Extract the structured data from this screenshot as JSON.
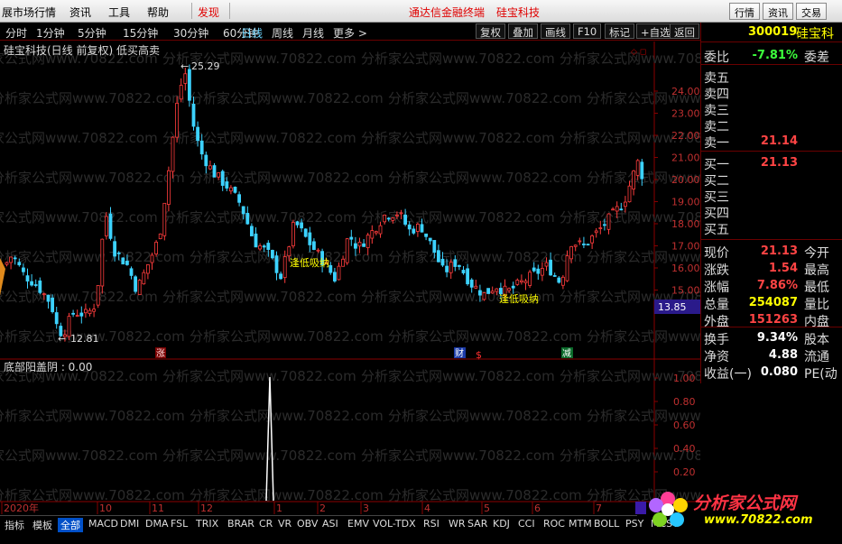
{
  "menu": {
    "items": [
      "展市场行情",
      "资讯",
      "工具",
      "帮助"
    ],
    "discover": "发现",
    "center_title": "通达信金融终端",
    "stock_name_top": "硅宝科技",
    "right_buttons": [
      "行情",
      "资讯",
      "交易"
    ]
  },
  "periods": [
    "分时",
    "1分钟",
    "5分钟",
    "15分钟",
    "30分钟",
    "60分钟",
    "日线",
    "周线",
    "月线",
    "更多 >"
  ],
  "active_period": "日线",
  "toolbar": [
    "复权",
    "叠加",
    "画线",
    "F10",
    "标记",
    "+自选",
    "返回"
  ],
  "chart": {
    "title": "硅宝科技(日线 前复权) 低买高卖",
    "high_label": "25.29",
    "low_label": "12.81",
    "signal_label": "逢低吸纳",
    "current_price_tag": "13.85",
    "price_ticks": [
      "24.00",
      "23.00",
      "22.00",
      "21.00",
      "20.00",
      "19.00",
      "18.00",
      "17.00",
      "16.00",
      "15.00"
    ],
    "event_marks": [
      "涨",
      "财",
      "$",
      "减"
    ],
    "indicator_title": "底部阳盖阴 : 0.00",
    "indicator_ticks": [
      "1.00",
      "0.80",
      "0.60",
      "0.40",
      "0.20"
    ],
    "date_labels": [
      "2020年",
      "10",
      "11",
      "12",
      "1",
      "2",
      "3",
      "4",
      "5",
      "6",
      "7"
    ],
    "watermark": "分析家公式网www.70822.com"
  },
  "quote": {
    "code": "300019",
    "name": "硅宝科",
    "weibi_label": "委比",
    "weibi_value": "-7.81%",
    "weicha_label": "委差",
    "sell_labels": [
      "卖五",
      "卖四",
      "卖三",
      "卖二",
      "卖一"
    ],
    "sell_values": [
      "",
      "",
      "",
      "",
      "21.14"
    ],
    "buy_labels": [
      "买一",
      "买二",
      "买三",
      "买四",
      "买五"
    ],
    "buy_values": [
      "21.13",
      "",
      "",
      "",
      ""
    ],
    "stats": [
      {
        "label": "现价",
        "value": "21.13",
        "label2": "今开",
        "color": "#ff4444"
      },
      {
        "label": "涨跌",
        "value": "1.54",
        "label2": "最高",
        "color": "#ff4444"
      },
      {
        "label": "涨幅",
        "value": "7.86%",
        "label2": "最低",
        "color": "#ff4444"
      },
      {
        "label": "总量",
        "value": "254087",
        "label2": "量比",
        "color": "#ffff00"
      },
      {
        "label": "外盘",
        "value": "151263",
        "label2": "内盘",
        "color": "#ff4444"
      },
      {
        "label": "换手",
        "value": "9.34%",
        "label2": "股本",
        "color": "#ffffff"
      },
      {
        "label": "净资",
        "value": "4.88",
        "label2": "流通",
        "color": "#ffffff"
      },
      {
        "label": "收益(一)",
        "value": "0.080",
        "label2": "PE(动",
        "color": "#ffffff"
      }
    ]
  },
  "indicator_tabs": [
    "指标",
    "模板",
    "全部",
    "MACD",
    "DMI",
    "DMA",
    "FSL",
    "TRIX",
    "BRAR",
    "CR",
    "VR",
    "OBV",
    "ASI",
    "EMV",
    "VOL-TDX",
    "RSI",
    "WR",
    "SAR",
    "KDJ",
    "CCI",
    "ROC",
    "MTM",
    "BOLL",
    "PSY",
    "MCST"
  ],
  "active_tab": "全部",
  "logo": {
    "text": "分析家公式网",
    "url": "www.70822.com"
  },
  "colors": {
    "up": "#ff3c3c",
    "down": "#3cd2ff",
    "accent": "#ffff00",
    "grid": "#6a0000"
  }
}
